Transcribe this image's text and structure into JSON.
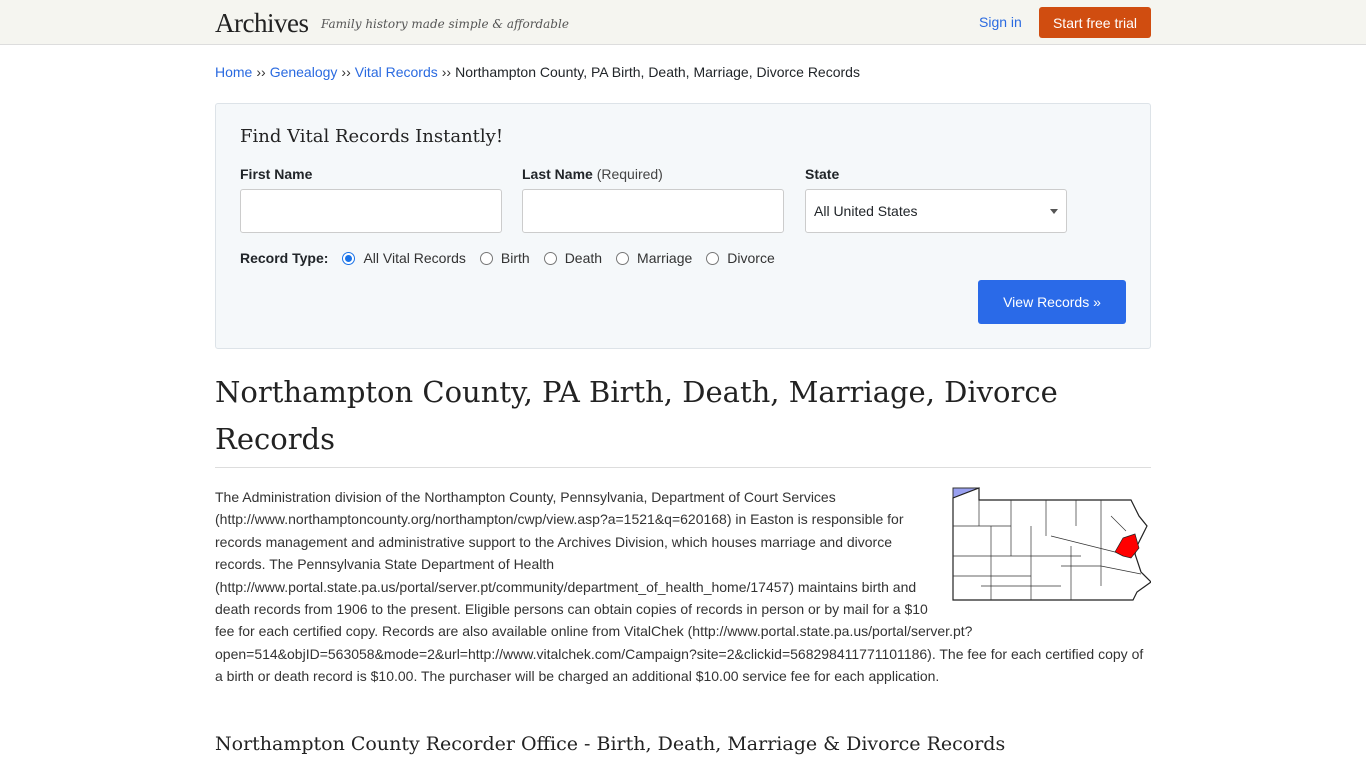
{
  "header": {
    "logo": "Archives",
    "tagline": "Family history made simple & affordable",
    "sign_in": "Sign in",
    "trial": "Start free trial"
  },
  "breadcrumb": {
    "items": [
      "Home",
      "Genealogy",
      "Vital Records"
    ],
    "separator": "››",
    "current": "Northampton County, PA Birth, Death, Marriage, Divorce Records"
  },
  "search": {
    "title": "Find Vital Records Instantly!",
    "first_name_label": "First Name",
    "last_name_label": "Last Name",
    "last_name_required": "(Required)",
    "state_label": "State",
    "state_value": "All United States",
    "record_type_label": "Record Type:",
    "record_types": [
      "All Vital Records",
      "Birth",
      "Death",
      "Marriage",
      "Divorce"
    ],
    "selected_record_type": "All Vital Records",
    "submit": "View Records »"
  },
  "article": {
    "title": "Northampton County, PA Birth, Death, Marriage, Divorce Records",
    "body": "The Administration division of the Northampton County, Pennsylvania, Department of Court Services (http://www.northamptoncounty.org/northampton/cwp/view.asp?a=1521&q=620168) in Easton is responsible for records management and administrative support to the Archives Division, which houses marriage and divorce records. The Pennsylvania State Department of Health (http://www.portal.state.pa.us/portal/server.pt/community/department_of_health_home/17457) maintains birth and death records from 1906 to the present. Eligible persons can obtain copies of records in person or by mail for a $10 fee for each certified copy. Records are also available online from VitalChek (http://www.portal.state.pa.us/portal/server.pt?open=514&objID=563058&mode=2&url=http://www.vitalchek.com/Campaign?site=2&clickid=568298411771101186). The fee for each certified copy of a birth or death record is $10.00. The purchaser will be charged an additional $10.00 service fee for each application.",
    "subheading": "Northampton County Recorder Office - Birth, Death, Marriage & Divorce Records"
  },
  "colors": {
    "link": "#2a6ae0",
    "trial": "#d04d10",
    "submit": "#2a6ae8",
    "county_highlight": "#ff0000"
  }
}
